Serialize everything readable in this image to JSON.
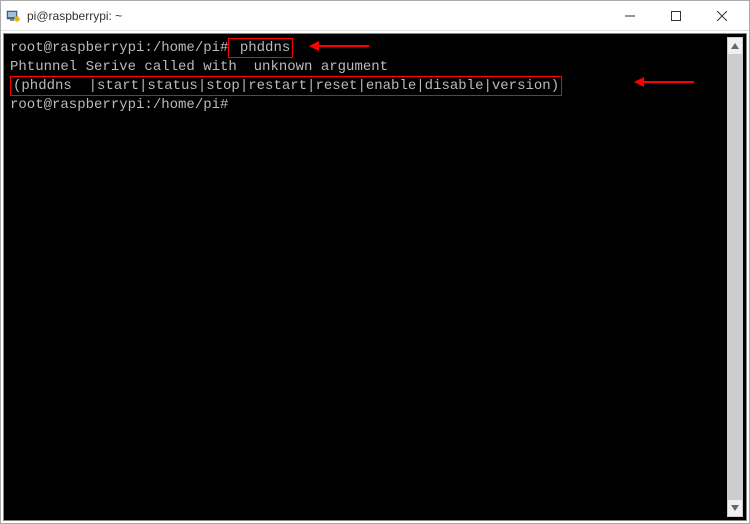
{
  "window": {
    "title": "pi@raspberrypi: ~"
  },
  "terminal": {
    "line1_prompt": "root@raspberrypi:/home/pi#",
    "line1_cmd": " phddns",
    "line2": "Phtunnel Serive called with  unknown argument",
    "line3": "(phddns  |start|status|stop|restart|reset|enable|disable|version)",
    "line4_prompt": "root@raspberrypi:/home/pi#"
  }
}
